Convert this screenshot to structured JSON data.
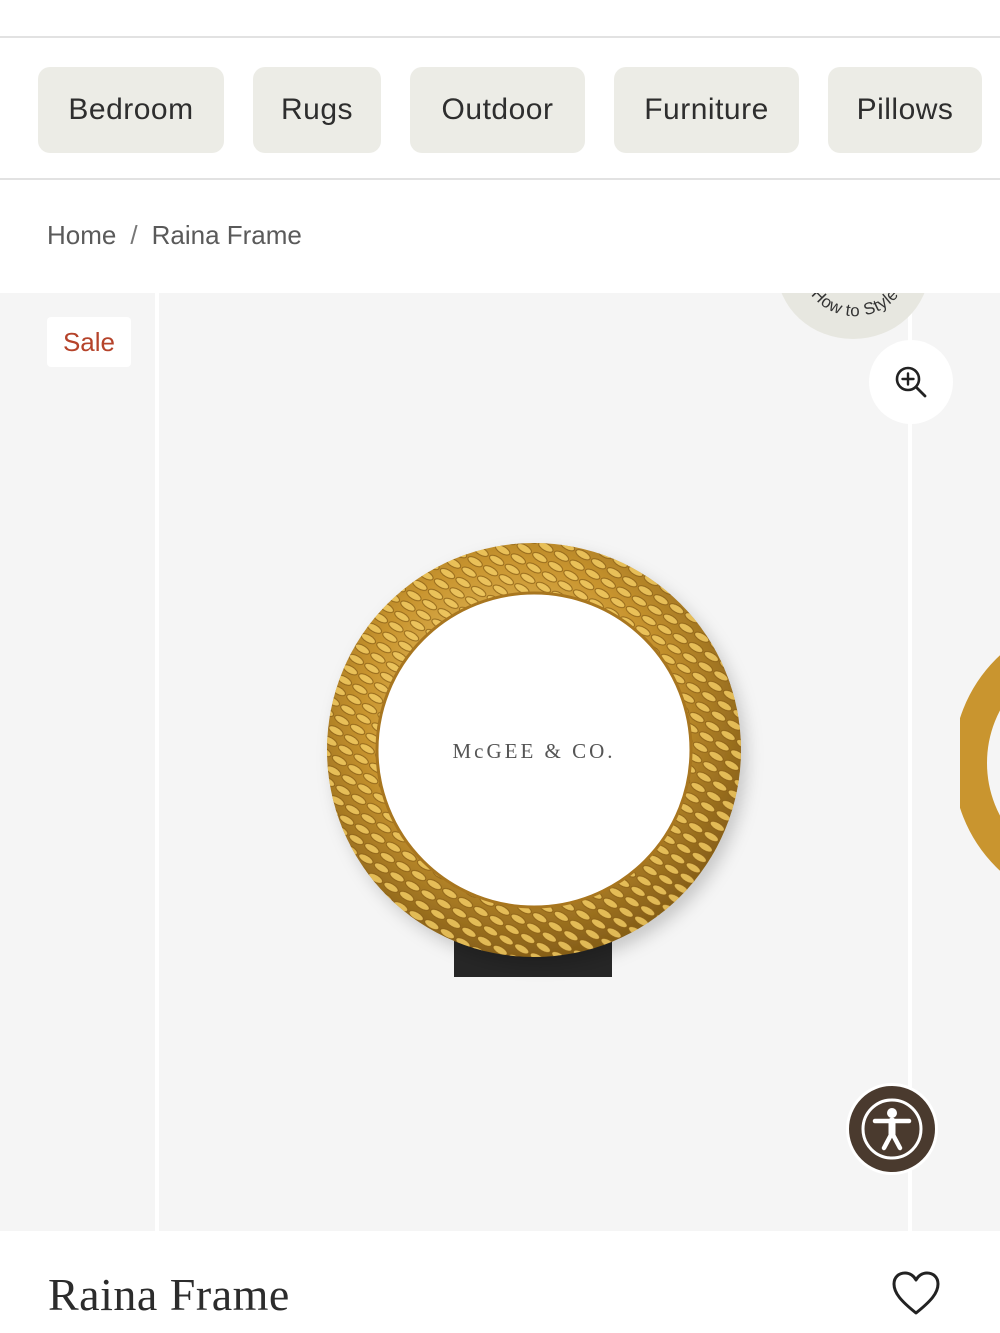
{
  "categories": [
    {
      "label": "Bedroom"
    },
    {
      "label": "Rugs"
    },
    {
      "label": "Outdoor"
    },
    {
      "label": "Furniture"
    },
    {
      "label": "Pillows"
    }
  ],
  "breadcrumb": {
    "home": "Home",
    "separator": "/",
    "current": "Raina Frame"
  },
  "gallery": {
    "sale_badge": "Sale",
    "how_to_style": "How to Style",
    "zoom_icon": "zoom-in-icon",
    "frame_brand_text": "McGEE & CO."
  },
  "accessibility": {
    "icon": "accessibility-person-icon"
  },
  "product": {
    "title": "Raina Frame",
    "wishlist_icon": "heart-icon"
  },
  "colors": {
    "chip_background": "#ececE6",
    "sale_text": "#b5432a",
    "a11y_button": "#4a3a2e",
    "frame_gold": "#c9952f"
  }
}
